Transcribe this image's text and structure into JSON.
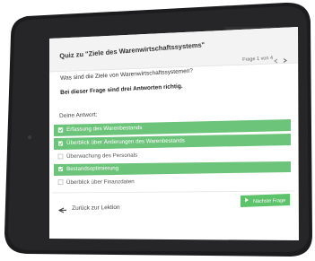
{
  "quiz": {
    "title": "Quiz zu \"Ziele des Warenwirtschaftssystems\"",
    "progress": "Frage 1 von 4",
    "question": "Was sind die Ziele von Warenwirtschaftssystemen?",
    "hint": "Bei dieser Frage sind drei Antworten richtig.",
    "answer_label": "Deine Antwort:",
    "options": [
      {
        "label": "Erfassung des Warenbestands",
        "checked": true
      },
      {
        "label": "Überblick über Änderungen des Warenbestands",
        "checked": true
      },
      {
        "label": "Überwachung des Personals",
        "checked": false
      },
      {
        "label": "Bestandsoptimierung",
        "checked": true
      },
      {
        "label": "Überblick über Finanzdaten",
        "checked": false
      }
    ],
    "back_label": "Zurück zur Lektion",
    "next_label": "Nächste Frage"
  },
  "colors": {
    "selected": "#6cc47a",
    "bezel": "#1c1c1e",
    "header_bg": "#f3f3f3",
    "next_button": "#5cc36a"
  },
  "icons": {
    "prev": "chevron-left-icon",
    "next": "chevron-right-icon",
    "back": "arrow-left-icon",
    "play": "play-icon"
  }
}
